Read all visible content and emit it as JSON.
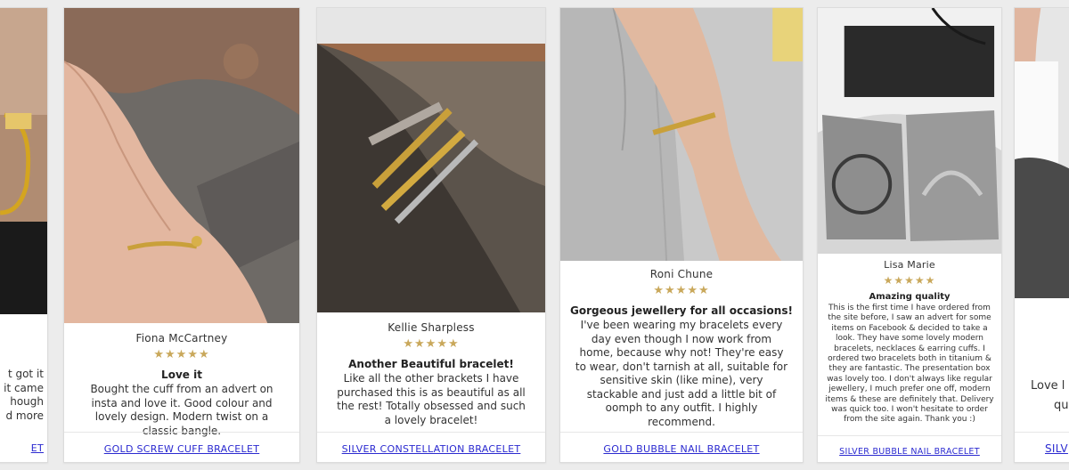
{
  "cards": [
    {
      "name": "",
      "stars": "★★★★★",
      "heading": "",
      "body_lines": [
        "t got it",
        "it came",
        "hough",
        "d more"
      ],
      "link": "ET"
    },
    {
      "name": "Fiona McCartney",
      "stars": "★★★★★",
      "heading": "Love it",
      "body": "Bought the cuff from an advert on insta and love it. Good colour and lovely design. Modern twist on a classic bangle.",
      "link": "GOLD SCREW CUFF BRACELET"
    },
    {
      "name": "Kellie Sharpless",
      "stars": "★★★★★",
      "heading": "Another Beautiful bracelet!",
      "body": "Like all the other brackets I have purchased this is as beautiful as all the rest! Totally obsessed and such a lovely bracelet!",
      "link": "SILVER CONSTELLATION BRACELET"
    },
    {
      "name": "Roni Chune",
      "stars": "★★★★★",
      "heading": "Gorgeous jewellery for all occasions!",
      "body": "I've been wearing my bracelets every day even though I now work from home, because why not! They're easy to wear, don't tarnish at all, suitable for sensitive skin (like mine), very stackable and just add a little bit of oomph to any outfit. I highly recommend.",
      "link": "GOLD BUBBLE NAIL BRACELET"
    },
    {
      "name": "Lisa Marie",
      "stars": "★★★★★",
      "heading": "Amazing quality",
      "body": "This is the first time I have ordered from the site before, I saw an advert for some items on Facebook & decided to take a look. They have some lovely modern bracelets, necklaces & earring cuffs. I ordered two bracelets both in titanium & they are fantastic. The presentation box was lovely too. I don't always like regular jewellery, I much prefer one off, modern items & these are definitely that. Delivery was quick too. I won't hesitate to order from the site again. Thank you :)",
      "link": "SILVER BUBBLE NAIL BRACELET"
    },
    {
      "name": "",
      "stars": "",
      "heading": "",
      "body_lines": [
        "Love l",
        "qu"
      ],
      "link": "SILV"
    }
  ],
  "colors": {
    "star": "#c9a85b",
    "link": "#2b2ad0"
  }
}
